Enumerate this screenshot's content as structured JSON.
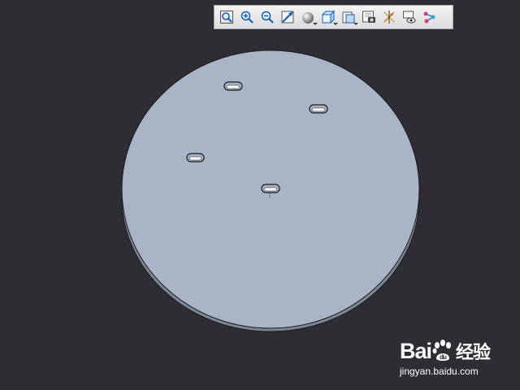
{
  "toolbar": {
    "buttons": [
      {
        "name": "zoom-window-icon"
      },
      {
        "name": "zoom-in-icon"
      },
      {
        "name": "zoom-out-icon"
      },
      {
        "name": "zoom-fit-icon"
      },
      {
        "name": "display-style-icon"
      },
      {
        "name": "view-orientation-icon"
      },
      {
        "name": "named-views-icon"
      },
      {
        "name": "screenshot-icon"
      },
      {
        "name": "datum-display-icon"
      },
      {
        "name": "show-hide-icon"
      },
      {
        "name": "annotation-display-icon"
      }
    ]
  },
  "colors": {
    "background": "#2e2d33",
    "part_face": "#a9b5c7",
    "part_side": "#7b8593",
    "edge": "#1c1c1c"
  },
  "watermark": {
    "brand_latin": "Bai",
    "brand_paw": "du",
    "brand_cn": "经验",
    "url": "jingyan.baidu.com"
  }
}
